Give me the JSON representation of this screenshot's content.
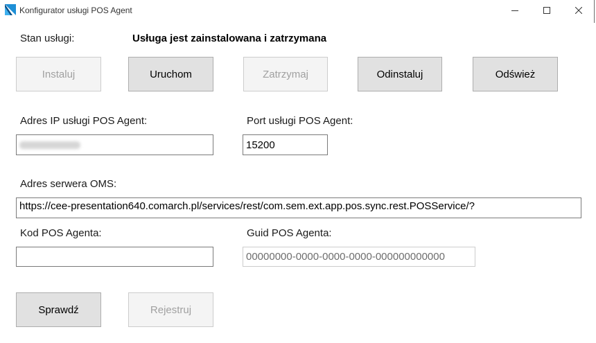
{
  "window": {
    "title": "Konfigurator usługi POS Agent"
  },
  "service": {
    "status_label": "Stan usługi:",
    "status_value": "Usługa jest zainstalowana i zatrzymana"
  },
  "buttons": {
    "install": "Instaluj",
    "start": "Uruchom",
    "stop": "Zatrzymaj",
    "uninstall": "Odinstaluj",
    "refresh": "Odśwież",
    "check": "Sprawdź",
    "register": "Rejestruj"
  },
  "fields": {
    "ip_label": "Adres IP usługi POS Agent:",
    "ip_value": "",
    "port_label": "Port usługi POS Agent:",
    "port_value": "15200",
    "oms_label": "Adres serwera OMS:",
    "oms_value": "https://cee-presentation640.comarch.pl/services/rest/com.sem.ext.app.pos.sync.rest.POSService/?",
    "code_label": "Kod POS Agenta:",
    "code_value": "",
    "guid_label": "Guid POS Agenta:",
    "guid_value": "00000000-0000-0000-0000-000000000000"
  },
  "icons": {
    "app": "app-logo-icon",
    "minimize": "minimize-icon",
    "maximize": "maximize-icon",
    "close": "close-icon"
  },
  "colors": {
    "logo_blue": "#1e8fd6",
    "logo_dark": "#0b4f86",
    "button_bg": "#e1e1e1",
    "button_border": "#adadad",
    "disabled_text": "#a0a0a0"
  }
}
